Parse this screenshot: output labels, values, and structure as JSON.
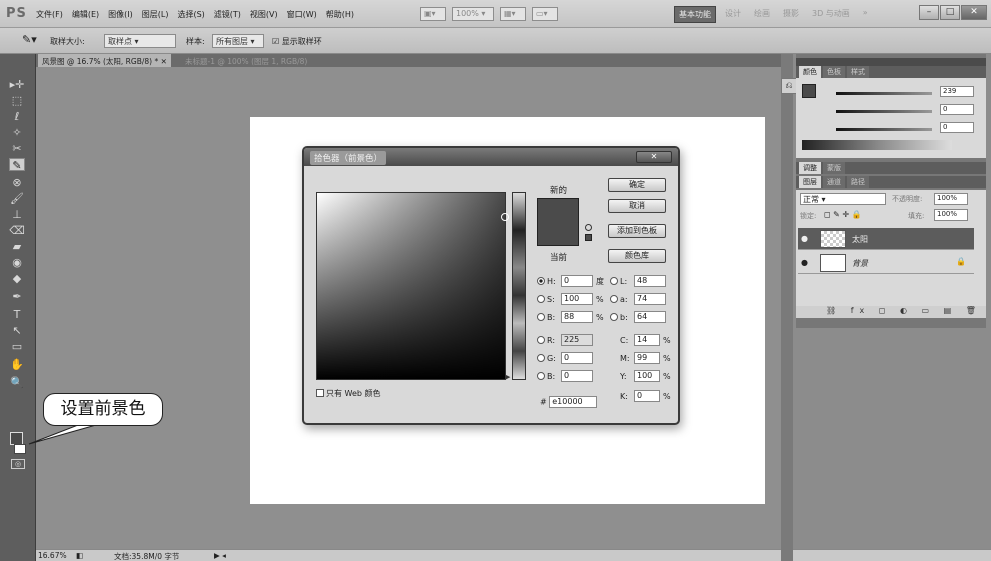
{
  "app": {
    "logo": "PS",
    "menu": [
      "文件(F)",
      "编辑(E)",
      "图像(I)",
      "图层(L)",
      "选择(S)",
      "滤镜(T)",
      "视图(V)",
      "窗口(W)",
      "帮助(H)"
    ],
    "zoom_widget": "100% ▾",
    "workspaces": [
      "基本功能",
      "设计",
      "绘画",
      "摄影",
      "3D 与动画",
      "»"
    ],
    "window_controls": [
      "–",
      "□",
      "✕"
    ]
  },
  "options": {
    "sample_size_label": "取样大小:",
    "sample_size_value": "取样点",
    "sample_label": "样本:",
    "sample_value": "所有图层",
    "show_ring_label": "显示取样环"
  },
  "document": {
    "tab_active": "风景图 @ 16.7% (太阳, RGB/8) * ✕",
    "tab_inactive": "未标题-1 @ 100% (图层 1, RGB/8)"
  },
  "status": {
    "zoom": "16.67%",
    "doc_info": "文档:35.8M/0 字节"
  },
  "color_panel": {
    "tabs": [
      "颜色",
      "色板",
      "样式"
    ],
    "values": [
      "239",
      "0",
      "0"
    ]
  },
  "adjust_tabs": [
    "调整",
    "蒙版"
  ],
  "layers_panel": {
    "tabs": [
      "图层",
      "通道",
      "路径"
    ],
    "blend_mode": "正常",
    "opacity_label": "不透明度:",
    "opacity_value": "100%",
    "lock_label": "锁定:",
    "fill_label": "填充:",
    "fill_value": "100%",
    "layers": [
      {
        "name": "太阳",
        "selected": true
      },
      {
        "name": "背景",
        "selected": false
      }
    ],
    "footer_icons": "⛓ fx ◻ ◐ ▭ ▤ 🗑"
  },
  "picker": {
    "title": "拾色器（前景色）",
    "close": "✕",
    "new_label": "新的",
    "current_label": "当前",
    "buttons": [
      "确定",
      "取消",
      "添加到色板",
      "颜色库"
    ],
    "new_color": "#4b4b4b",
    "fields_left": [
      {
        "label": "H:",
        "value": "0",
        "unit": "度",
        "selected": true
      },
      {
        "label": "S:",
        "value": "100",
        "unit": "%",
        "selected": false
      },
      {
        "label": "B:",
        "value": "88",
        "unit": "%",
        "selected": false
      },
      {
        "label": "R:",
        "value": "225",
        "unit": "",
        "selected": false
      },
      {
        "label": "G:",
        "value": "0",
        "unit": "",
        "selected": false
      },
      {
        "label": "B:",
        "value": "0",
        "unit": "",
        "selected": false
      }
    ],
    "fields_lab": [
      {
        "label": "L:",
        "value": "48"
      },
      {
        "label": "a:",
        "value": "74"
      },
      {
        "label": "b:",
        "value": "64"
      }
    ],
    "fields_cmyk": [
      {
        "label": "C:",
        "value": "14",
        "unit": "%"
      },
      {
        "label": "M:",
        "value": "99",
        "unit": "%"
      },
      {
        "label": "Y:",
        "value": "100",
        "unit": "%"
      },
      {
        "label": "K:",
        "value": "0",
        "unit": "%"
      }
    ],
    "web_only_label": "只有 Web 颜色",
    "hex_label": "#",
    "hex_value": "e10000"
  },
  "annotation": {
    "callout_text": "设置前景色"
  },
  "tools": [
    "▸✛",
    "⬚",
    "ℓ",
    "✧",
    "✂",
    "✎",
    "⊗",
    "🖌",
    "⊥",
    "⌫",
    "▰",
    "◉",
    "◆",
    "✒",
    "T",
    "↖",
    "▭",
    "✋",
    "🔍"
  ]
}
